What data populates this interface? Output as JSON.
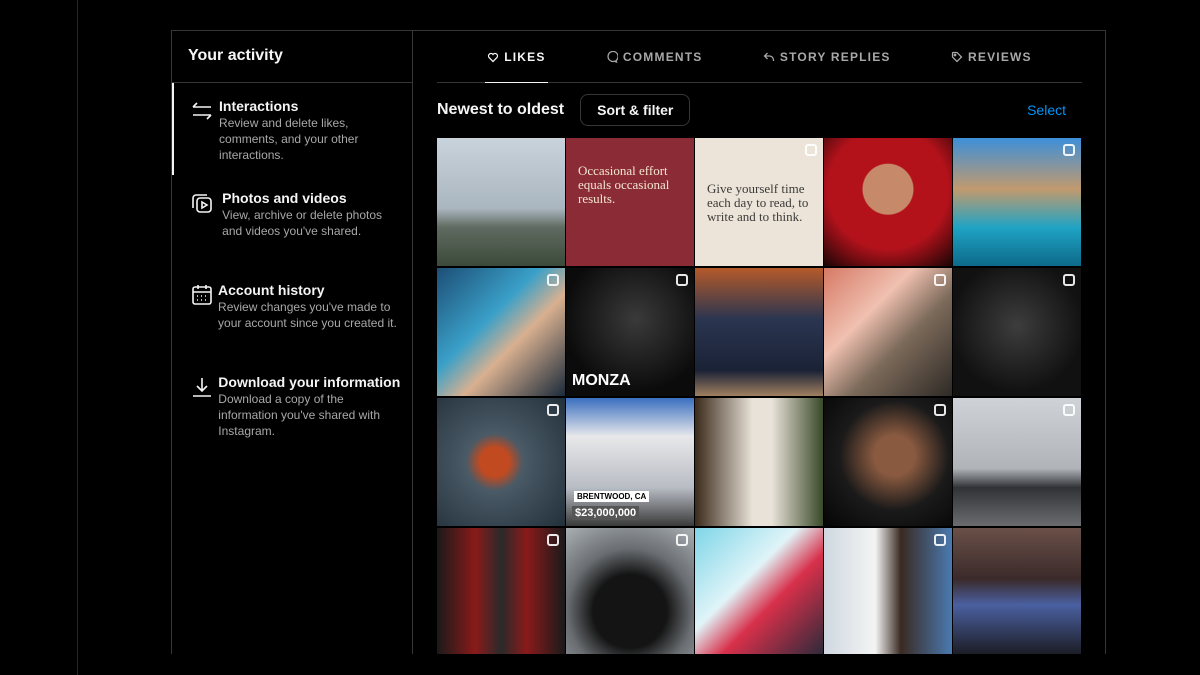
{
  "sidebar": {
    "title": "Your activity",
    "items": [
      {
        "icon": "arrows-swap-icon",
        "label": "Interactions",
        "description": "Review and delete likes, comments, and your other interactions."
      },
      {
        "icon": "photos-videos-icon",
        "label": "Photos and videos",
        "description": "View, archive or delete photos and videos you've shared."
      },
      {
        "icon": "calendar-icon",
        "label": "Account history",
        "description": "Review changes you've made to your account since you created it."
      },
      {
        "icon": "download-icon",
        "label": "Download your information",
        "description": "Download a copy of the information you've shared with Instagram."
      }
    ]
  },
  "tabs": [
    {
      "icon": "heart-icon",
      "label": "LIKES",
      "active": true
    },
    {
      "icon": "comment-icon",
      "label": "COMMENTS"
    },
    {
      "icon": "reply-icon",
      "label": "STORY REPLIES"
    },
    {
      "icon": "tag-icon",
      "label": "REVIEWS"
    }
  ],
  "toolbar": {
    "sort_order": "Newest to oldest",
    "sort_filter": "Sort & filter",
    "select": "Select"
  },
  "accent": "#0095f6",
  "posts": [
    {
      "bg": "linear-gradient(#c9d3dc 0%,#aab6bf 55%,#5f6a60 70%,#3b4a3a 100%)"
    },
    {
      "bg": "#8a2b35",
      "text": "Occasional effort equals occasional results.",
      "multi": false
    },
    {
      "bg": "#ece4d8",
      "text": "Give yourself time each day to read, to write and to think.",
      "dark": true,
      "multi": true
    },
    {
      "bg": "radial-gradient(circle at 50% 40%,#c68a6a 0 25%,#b3121b 26% 60%,#1a0505 100%)"
    },
    {
      "bg": "linear-gradient(#3d8fd9 0%,#c29a6e 40%,#1fa3c4 70%,#0d6a8a 100%)",
      "multi": true
    },
    {
      "bg": "linear-gradient(135deg,#1d4e76,#3aa0c8 40%,#d8b090 60%,#1b2a3a)",
      "multi": true
    },
    {
      "bg": "radial-gradient(circle at 55% 40%,#3a3a3a,#0b0b0b 70%)",
      "caption": "MONZA",
      "multi": true
    },
    {
      "bg": "linear-gradient(#b55a2a 0%,#2a3550 40%,#1a2236 80%,#a08060 100%)"
    },
    {
      "bg": "linear-gradient(135deg,#d67a66,#f0c0b0 35%,#7c6a5a 60%,#2e2a26)",
      "multi": true
    },
    {
      "bg": "radial-gradient(circle at 50% 45%,#3d3d3d,#111 70%)",
      "multi": true
    },
    {
      "bg": "radial-gradient(circle at 45% 50%,#c24a20 0 15%,#4a5a66 30%,#22303a 100%)",
      "multi": true
    },
    {
      "bg": "linear-gradient(#3a6fc0 0%,#e8e8ea 30%,#b8bcc4 70%,#3a3a3a 100%)",
      "caption": "$23,000,000",
      "sub": "BRENTWOOD, CA"
    },
    {
      "bg": "linear-gradient(90deg,#3a2a1a,#e8e2d8 45%,#e8e2d8 60%,#3a4a2a)"
    },
    {
      "bg": "radial-gradient(circle at 55% 45%,#8a5a40 0 20%,#1a1a1a 55%,#050505)",
      "multi": true
    },
    {
      "bg": "linear-gradient(#cfd3d8 0%,#b0b4b8 55%,#303236 70%,#6a6c70 100%)",
      "multi": true
    },
    {
      "bg": "linear-gradient(90deg,#1a1a1a,#8a1a1a 30%,#2a2a2a 50%,#8a1a1a 70%,#1a1a1a)",
      "multi": true
    },
    {
      "bg": "radial-gradient(circle at 50% 65%,#141414 0 35%,#6a6e72 60%,#aab0b4)",
      "multi": true
    },
    {
      "bg": "linear-gradient(135deg,#7fd6e8,#e0f4f8 40%,#d8304a 60%,#2a2a3a)"
    },
    {
      "bg": "linear-gradient(90deg,#cfd8e0,#f4f4f4 40%,#3a2a22 60%,#4a7ab0)",
      "multi": true
    },
    {
      "bg": "linear-gradient(#6a5048 0%,#3a2a2a 40%,#4a60a0 60%,#1a1a20 100%)"
    }
  ]
}
